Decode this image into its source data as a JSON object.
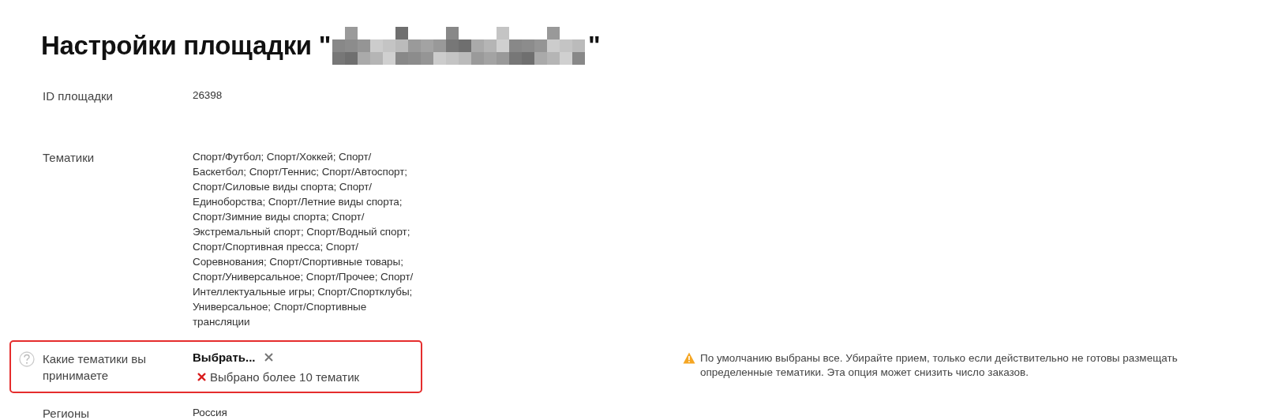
{
  "title": {
    "text": "Настройки площадки \"",
    "closing_quote": "\""
  },
  "fields": [
    {
      "kind": "text",
      "label": "ID площадки",
      "value": "26398",
      "invalid": false
    },
    {
      "kind": "text",
      "label": "Тематики",
      "value": "Спорт/Футбол; Спорт/Хоккей; Спорт/Баскетбол; Спорт/Теннис; Спорт/Автоспорт; Спорт/Силовые виды спорта; Спорт/Единоборства; Спорт/Летние виды спорта; Спорт/Зимние виды спорта; Спорт/Экстремальный спорт; Спорт/Водный спорт; Спорт/Спортивная пресса; Спорт/Соревнования; Спорт/Спортивные товары; Спорт/Универсальное; Спорт/Прочее; Спорт/Интеллектуальные игры; Спорт/Спортклубы; Универсальное; Спорт/Спортивные трансляции",
      "invalid": false
    },
    {
      "kind": "select",
      "label": "Какие тематики вы принимаете",
      "value": "Выбрать...",
      "error": "Выбрано более 10 тематик",
      "hint": "По умолчанию выбраны все. Убирайте прием, только если действительно не готовы размещать определенные тематики. Эта опция может снизить число заказов.",
      "invalid": true
    },
    {
      "kind": "text",
      "label": "Регионы",
      "value": "Россия",
      "invalid": false
    }
  ]
}
